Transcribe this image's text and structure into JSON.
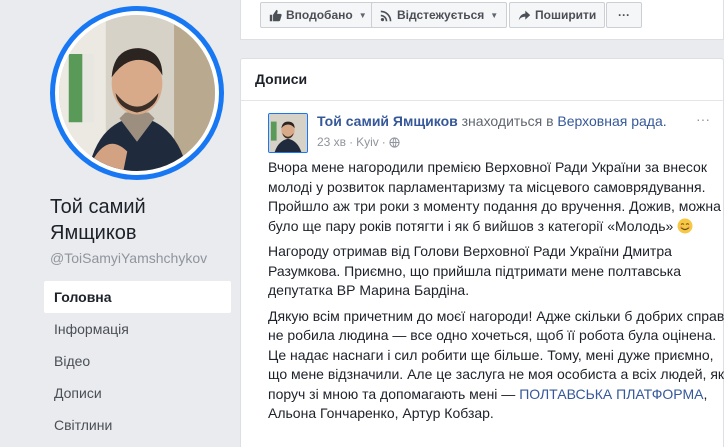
{
  "left": {
    "page_name": "Той самий Ямщиков",
    "handle": "@ToiSamyiYamshchykov",
    "nav": [
      {
        "label": "Головна",
        "active": true
      },
      {
        "label": "Інформація"
      },
      {
        "label": "Відео"
      },
      {
        "label": "Дописи"
      },
      {
        "label": "Світлини"
      }
    ]
  },
  "actions": {
    "like_label": "Вподобано",
    "follow_label": "Відстежується",
    "share_label": "Поширити",
    "more_label": "···"
  },
  "posts": {
    "header": "Дописи",
    "post": {
      "author": "Той самий Ямщиков",
      "location_text": "знаходиться в",
      "location": "Верховная рада.",
      "time": "23 хв",
      "city": "Kyiv",
      "menu": "···",
      "paragraphs": {
        "p1": "Вчора мене нагородили премією Верховної Ради України за внесок молоді у розвиток парламентаризму та місцевого самоврядування. Пройшло аж три роки з моменту подання до вручення. Дожив, можна було ще пару років потягти і як б вийшов з категорії «Молодь»",
        "p2": "Нагороду отримав від Голови Верховної Ради України Дмитра Разумкова. Приємно, що прийшла підтримати мене полтавська депутатка ВР Марина Бардіна.",
        "p3_start": "Дякую всім причетним до моєї нагороди! Адже скільки б добрих справ не робила людина — все одно хочеться, щоб її робота була оцінена. Це надає наснаги і сил робити ще більше. Тому, мені дуже приємно, що мене відзначили. Але це заслуга не моя особиста а всіх людей, які поруч зі мною та допомагають мені —",
        "p3_link": "ПОЛТАВСЬКА ПЛАТФОРМА",
        "p3_end": ", Альона Гончаренко, Артур Кобзар."
      }
    }
  },
  "colors": {
    "link": "#365899",
    "accent": "#1877f2",
    "background": "#e9ebee"
  },
  "icons": [
    "thumbs-up-icon",
    "rss-icon",
    "share-arrow-icon",
    "globe-icon",
    "smile-emoji-icon"
  ]
}
